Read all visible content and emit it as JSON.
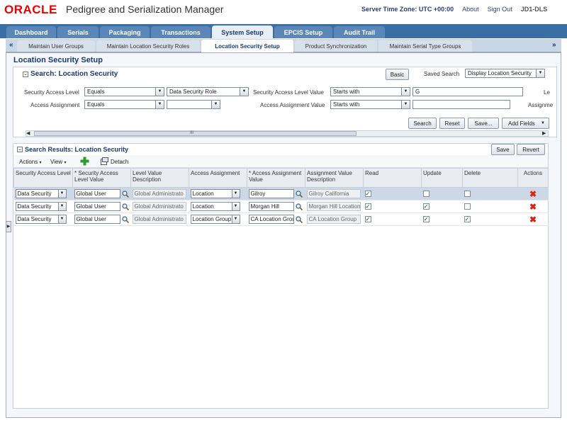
{
  "header": {
    "logo": "ORACLE",
    "title": "Pedigree and Serialization Manager",
    "timezone": "Server Time Zone: UTC +00:00",
    "about": "About",
    "signout": "Sign Out",
    "user": "JD1-DLS"
  },
  "main_tabs": [
    "Dashboard",
    "Serials",
    "Packaging",
    "Transactions",
    "System Setup",
    "EPCIS Setup",
    "Audit Trail"
  ],
  "main_tab_active": "System Setup",
  "sub_tabs": [
    "Maintain User Groups",
    "Maintain Location Security Roles",
    "Location Security Setup",
    "Product Synchronization",
    "Maintain Serial Type Groups"
  ],
  "sub_tab_active": "Location Security Setup",
  "page_title": "Location Security Setup",
  "search": {
    "title": "Search: Location Security",
    "basic_btn": "Basic",
    "saved_search_label": "Saved Search",
    "saved_search_value": "Display Location Security",
    "row1": {
      "field1_label": "Security Access Level",
      "field1_op": "Equals",
      "field1_value": "Data Security Role",
      "field2_label": "Security Access Level Value",
      "field2_op": "Starts with",
      "field2_value": "G",
      "field3_label": "Le"
    },
    "row2": {
      "field1_label": "Access Assignment",
      "field1_op": "Equals",
      "field1_value": "",
      "field2_label": "Access Assignment Value",
      "field2_op": "Starts with",
      "field2_value": "",
      "field3_label": "Assignme"
    },
    "search_btn": "Search",
    "reset_btn": "Reset",
    "save_btn": "Save...",
    "add_fields_btn": "Add Fields",
    "scroll_grip": "III"
  },
  "results": {
    "title": "Search Results: Location Security",
    "save_btn": "Save",
    "revert_btn": "Revert",
    "actions_menu": "Actions",
    "view_menu": "View",
    "detach_btn": "Detach",
    "columns": [
      "Security Access Level",
      "* Security Access Level Value",
      "Level Value Description",
      "Access Assignment",
      "* Access Assignment Value",
      "Assignment Value Description",
      "Read",
      "Update",
      "Delete",
      "Actions"
    ],
    "rows": [
      {
        "level": "Data Security",
        "level_value": "Global User",
        "level_desc": "Global Administrato",
        "assignment": "Location",
        "assign_value": "Gilroy",
        "assign_desc": "Gilroy California",
        "read": true,
        "update": false,
        "delete": false,
        "selected": true
      },
      {
        "level": "Data Security",
        "level_value": "Global User",
        "level_desc": "Global Administrato",
        "assignment": "Location",
        "assign_value": "Morgan Hill",
        "assign_desc": "Morgan Hill Location",
        "read": true,
        "update": true,
        "delete": false,
        "selected": false
      },
      {
        "level": "Data Security",
        "level_value": "Global User",
        "level_desc": "Global Administrato",
        "assignment": "Location Group",
        "assign_value": "CA Location Grou",
        "assign_desc": "CA Location Group",
        "read": true,
        "update": true,
        "delete": true,
        "selected": false
      }
    ]
  },
  "colors": {
    "brand_red": "#e00000",
    "tab_blue": "#3a6ea5",
    "title_blue": "#1a3b6e",
    "delete_red": "#dd2211"
  }
}
